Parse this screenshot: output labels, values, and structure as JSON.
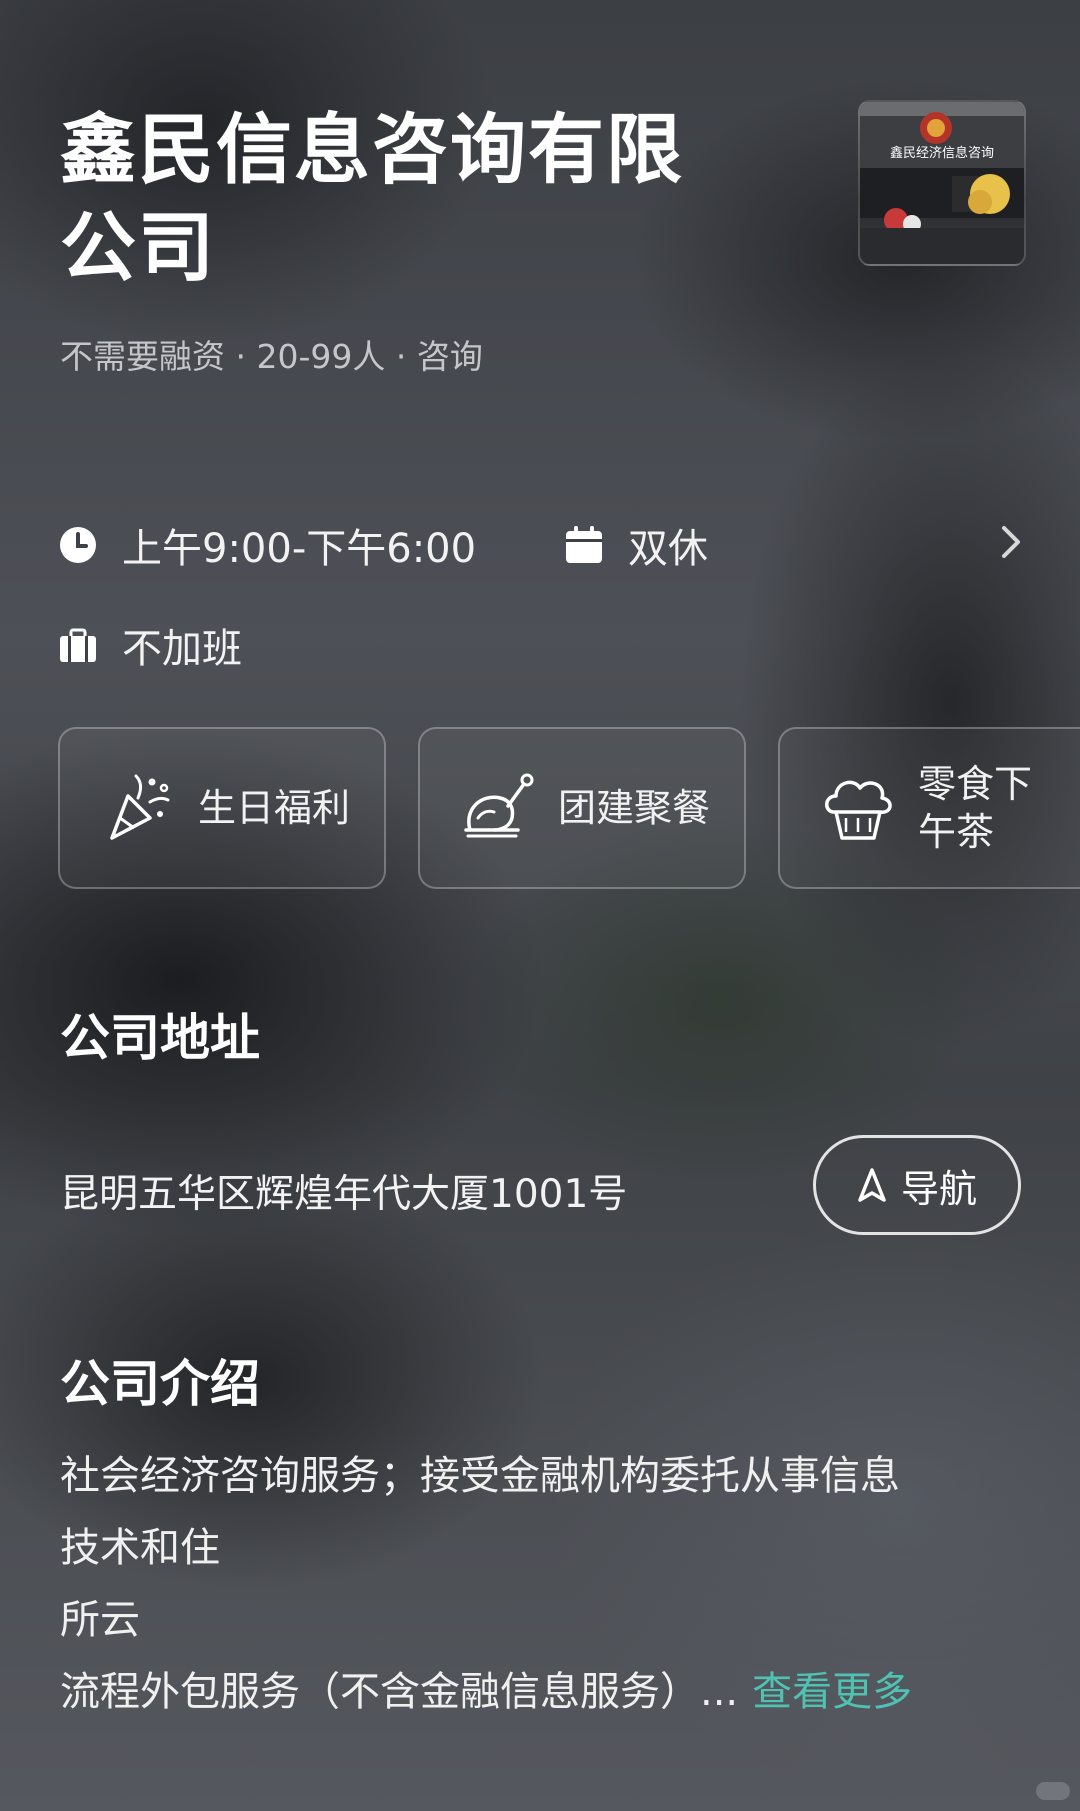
{
  "company": {
    "name": "鑫民信息咨询有限公司",
    "meta": "不需要融资 · 20-99人 · 咨询",
    "logo_text": "鑫民经济信息咨询"
  },
  "work_info": {
    "hours": "上午9:00-下午6:00",
    "weekend": "双休",
    "overtime": "不加班"
  },
  "benefits": [
    {
      "label": "生日福利",
      "icon": "party-popper-icon"
    },
    {
      "label": "团建聚餐",
      "icon": "roast-chicken-icon"
    },
    {
      "label": "零食下午茶",
      "icon": "cupcake-icon"
    }
  ],
  "address": {
    "title": "公司地址",
    "text": "昆明五华区辉煌年代大厦1001号",
    "nav_label": "导航"
  },
  "intro": {
    "title": "公司介绍",
    "lines": [
      "社会经济咨询服务；接受金融机构委托从事信息",
      "技术和住",
      "所云",
      "流程外包服务（不含金融信息服务）..."
    ],
    "see_more": "查看更多"
  },
  "colors": {
    "accent": "#4fc2b3",
    "text": "#ffffff",
    "muted": "#c4c6c9"
  }
}
